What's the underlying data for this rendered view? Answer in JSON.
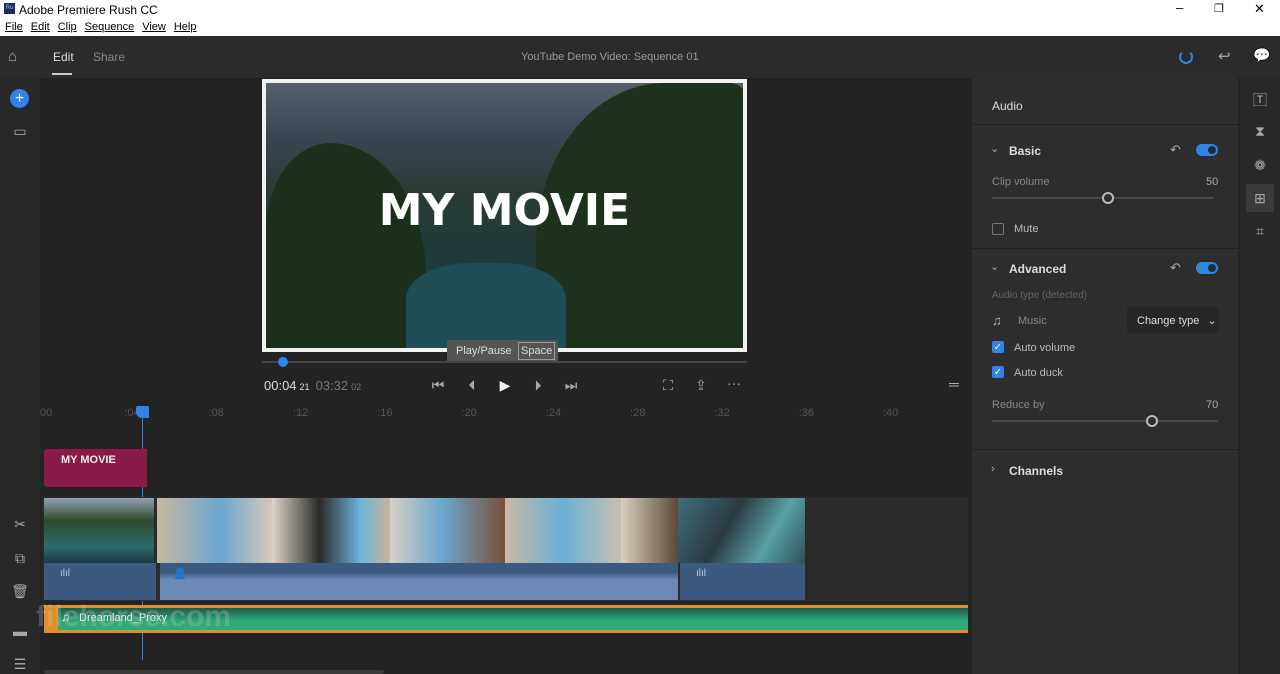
{
  "window": {
    "title": "Adobe Premiere Rush CC",
    "app_icon": "Ru",
    "controls": [
      "minimize",
      "restore",
      "close"
    ]
  },
  "menu": [
    "File",
    "Edit",
    "Clip",
    "Sequence",
    "View",
    "Help"
  ],
  "appbar": {
    "tabs": [
      {
        "label": "Edit",
        "active": true
      },
      {
        "label": "Share",
        "active": false
      }
    ],
    "project_title": "YouTube Demo Video: Sequence 01"
  },
  "preview": {
    "title_overlay": "MY MOVIE",
    "tooltip": {
      "label": "Play/Pause",
      "shortcut": "Space"
    },
    "current_time": "00:04",
    "current_frames": "21",
    "duration": "03:32",
    "duration_frames": "02",
    "progress_percent": 2.2
  },
  "timeline": {
    "ruler": [
      "00",
      ":04",
      ":08",
      ":12",
      ":16",
      ":20",
      ":24",
      ":28",
      ":32",
      ":36",
      ":40"
    ],
    "title_clip": "MY MOVIE",
    "music_clip": "Dreamland_Proxy",
    "watermark": "filehorse.com"
  },
  "panel": {
    "title": "Audio",
    "basic": {
      "label": "Basic",
      "enabled": true,
      "clip_volume_label": "Clip volume",
      "clip_volume": "50",
      "mute_label": "Mute",
      "mute": false
    },
    "advanced": {
      "label": "Advanced",
      "enabled": true,
      "audio_type_label": "Audio type (detected)",
      "audio_type": "Music",
      "change_type": "Change type",
      "auto_volume_label": "Auto volume",
      "auto_volume": true,
      "auto_duck_label": "Auto duck",
      "auto_duck": true,
      "reduce_by_label": "Reduce by",
      "reduce_by": "70"
    },
    "channels": {
      "label": "Channels"
    }
  },
  "colors": {
    "accent": "#2f84e4",
    "title_clip": "#8a1a48",
    "audio_track": "#3c5a80",
    "music_track": "#2faa78",
    "music_border": "#e0902a"
  }
}
